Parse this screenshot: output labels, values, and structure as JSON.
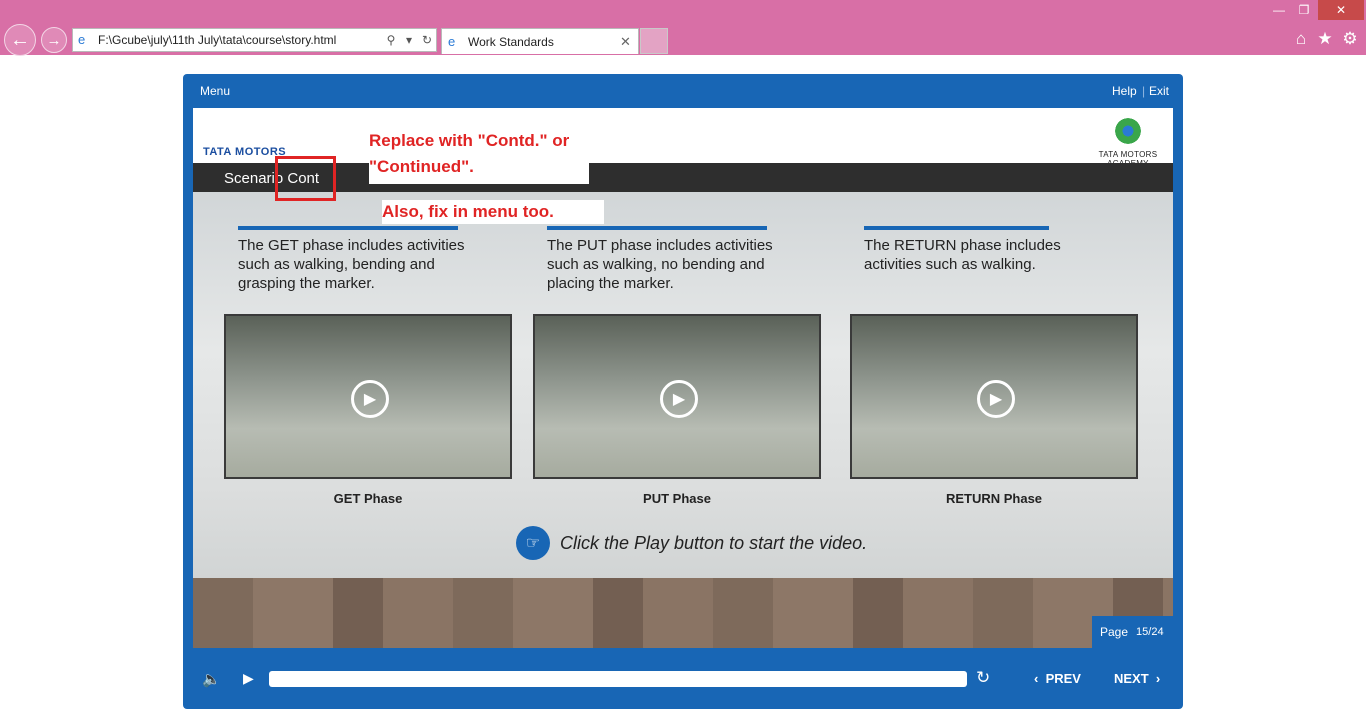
{
  "browser": {
    "address": "F:\\Gcube\\july\\11th July\\tata\\course\\story.html",
    "tab_title": "Work Standards",
    "icons": [
      "back-arrow-icon",
      "forward-arrow-icon",
      "search-icon",
      "refresh-icon",
      "close-icon",
      "home-icon",
      "star-icon",
      "gear-icon"
    ]
  },
  "player": {
    "menu_label": "Menu",
    "help_label": "Help",
    "exit_label": "Exit",
    "separator": "|"
  },
  "slide": {
    "brand_left": "TATA MOTORS",
    "brand_right": "TATA MOTORS ACADEMY",
    "title": "Scenario Cont",
    "annotation_1": "Replace with \"Contd.\" or \"Continued\".",
    "annotation_2": "Also, fix in menu too.",
    "phases": [
      {
        "description": "The GET phase includes activities such as walking, bending and grasping the marker.",
        "label": "GET Phase"
      },
      {
        "description": "The PUT phase includes activities such as walking, no bending and placing the marker.",
        "label": "PUT Phase"
      },
      {
        "description": "The RETURN phase includes activities such as walking.",
        "label": "RETURN Phase"
      }
    ],
    "hint": "Click the Play button to start the video.",
    "page_label": "Page",
    "page_number": "15/24"
  },
  "controls": {
    "prev_label": "PREV",
    "next_label": "NEXT",
    "seek_progress": 0
  },
  "colors": {
    "player_blue": "#1866b5",
    "annotation_red": "#e02424",
    "chrome_pink": "#d86fa6"
  }
}
